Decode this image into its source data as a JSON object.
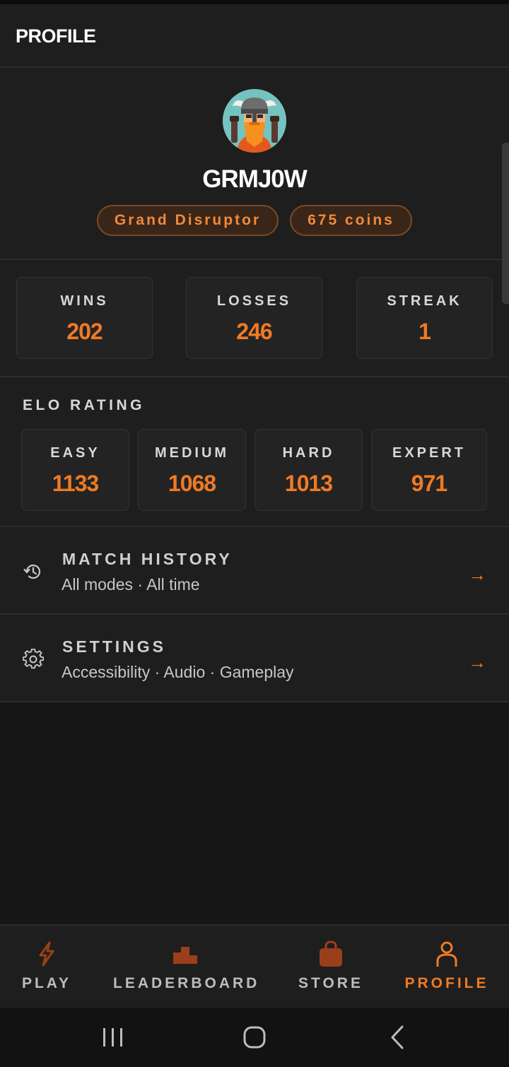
{
  "header": {
    "title": "PROFILE"
  },
  "profile": {
    "username": "GRMJ0W",
    "title_badge": "Grand Disruptor",
    "coins_badge": "675 coins"
  },
  "stats": [
    {
      "label": "WINS",
      "value": "202"
    },
    {
      "label": "LOSSES",
      "value": "246"
    },
    {
      "label": "STREAK",
      "value": "1"
    }
  ],
  "elo": {
    "heading": "ELO RATING",
    "ratings": [
      {
        "label": "EASY",
        "value": "1133"
      },
      {
        "label": "MEDIUM",
        "value": "1068"
      },
      {
        "label": "HARD",
        "value": "1013"
      },
      {
        "label": "EXPERT",
        "value": "971"
      }
    ]
  },
  "menu": [
    {
      "title": "MATCH HISTORY",
      "subtitle": "All modes · All time",
      "icon": "history-icon",
      "arrow": "→"
    },
    {
      "title": "SETTINGS",
      "subtitle": "Accessibility · Audio · Gameplay",
      "icon": "gear-icon",
      "arrow": "→"
    }
  ],
  "nav": {
    "items": [
      {
        "label": "PLAY",
        "icon": "lightning-icon"
      },
      {
        "label": "LEADERBOARD",
        "icon": "podium-icon"
      },
      {
        "label": "STORE",
        "icon": "shopping-bag-icon"
      },
      {
        "label": "PROFILE",
        "icon": "person-icon"
      }
    ],
    "active": "PROFILE"
  },
  "colors": {
    "accent": "#f07a24",
    "background": "#161616",
    "surface": "#1e1e1e",
    "card": "#232323",
    "badge_bg": "#3a2618",
    "badge_border": "#7a4a26"
  }
}
